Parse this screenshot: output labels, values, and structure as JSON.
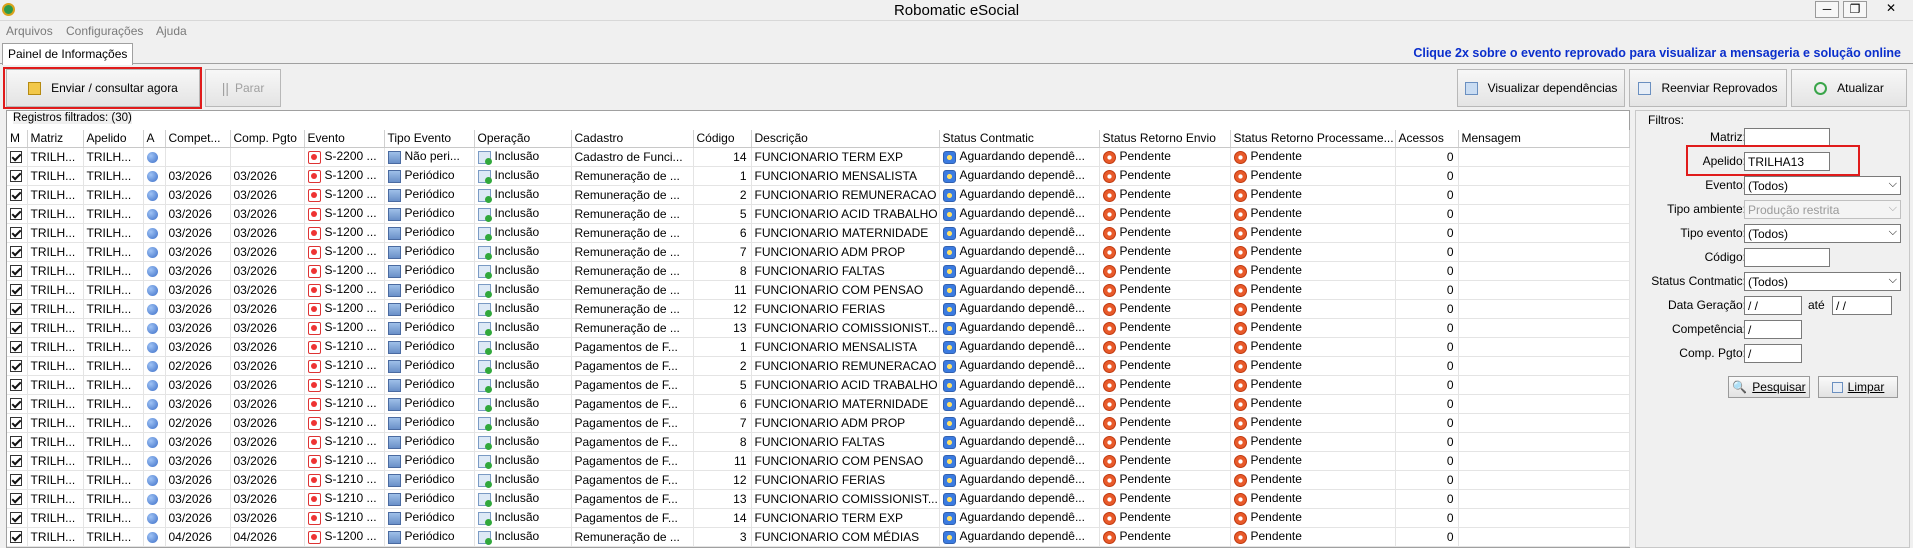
{
  "window": {
    "title": "Robomatic eSocial",
    "controls": [
      "─",
      "❐",
      "✕"
    ]
  },
  "menu": [
    "Arquivos",
    "Configurações",
    "Ajuda"
  ],
  "tab": "Painel de Informações",
  "hint": "Clique 2x sobre o evento reprovado para visualizar a mensageria e solução online",
  "toolbar": {
    "send": "Enviar / consultar agora",
    "stop": "Parar",
    "deps": "Visualizar dependências",
    "resend": "Reenviar Reprovados",
    "refresh": "Atualizar"
  },
  "records_label": "Registros filtrados: (30)",
  "columns": [
    "M",
    "Matriz",
    "Apelido",
    "A",
    "Compet...",
    "Comp. Pgto",
    "Evento",
    "Tipo Evento",
    "Operação",
    "Cadastro",
    "Código",
    "Descrição",
    "Status Contmatic",
    "Status Retorno Envio",
    "Status Retorno Processame...",
    "Acessos",
    "Mensagem"
  ],
  "rows": [
    {
      "matriz": "TRILH...",
      "apelido": "TRILH...",
      "compet": "",
      "comp_pgto": "",
      "evento": "S-2200 ...",
      "tipo": "Não peri...",
      "operacao": "Inclusão",
      "cadastro": "Cadastro de Funci...",
      "codigo": "14",
      "descricao": "FUNCIONARIO TERM EXP",
      "status": "Aguardando dependê...",
      "envio": "Pendente",
      "proc": "Pendente",
      "acessos": "0",
      "mensagem": ""
    },
    {
      "matriz": "TRILH...",
      "apelido": "TRILH...",
      "compet": "03/2026",
      "comp_pgto": "03/2026",
      "evento": "S-1200 ...",
      "tipo": "Periódico",
      "operacao": "Inclusão",
      "cadastro": "Remuneração de ...",
      "codigo": "1",
      "descricao": "FUNCIONARIO MENSALISTA",
      "status": "Aguardando dependê...",
      "envio": "Pendente",
      "proc": "Pendente",
      "acessos": "0",
      "mensagem": ""
    },
    {
      "matriz": "TRILH...",
      "apelido": "TRILH...",
      "compet": "03/2026",
      "comp_pgto": "03/2026",
      "evento": "S-1200 ...",
      "tipo": "Periódico",
      "operacao": "Inclusão",
      "cadastro": "Remuneração de ...",
      "codigo": "2",
      "descricao": "FUNCIONARIO REMUNERACAO",
      "status": "Aguardando dependê...",
      "envio": "Pendente",
      "proc": "Pendente",
      "acessos": "0",
      "mensagem": ""
    },
    {
      "matriz": "TRILH...",
      "apelido": "TRILH...",
      "compet": "03/2026",
      "comp_pgto": "03/2026",
      "evento": "S-1200 ...",
      "tipo": "Periódico",
      "operacao": "Inclusão",
      "cadastro": "Remuneração de ...",
      "codigo": "5",
      "descricao": "FUNCIONARIO ACID TRABALHO",
      "status": "Aguardando dependê...",
      "envio": "Pendente",
      "proc": "Pendente",
      "acessos": "0",
      "mensagem": ""
    },
    {
      "matriz": "TRILH...",
      "apelido": "TRILH...",
      "compet": "03/2026",
      "comp_pgto": "03/2026",
      "evento": "S-1200 ...",
      "tipo": "Periódico",
      "operacao": "Inclusão",
      "cadastro": "Remuneração de ...",
      "codigo": "6",
      "descricao": "FUNCIONARIO MATERNIDADE",
      "status": "Aguardando dependê...",
      "envio": "Pendente",
      "proc": "Pendente",
      "acessos": "0",
      "mensagem": ""
    },
    {
      "matriz": "TRILH...",
      "apelido": "TRILH...",
      "compet": "03/2026",
      "comp_pgto": "03/2026",
      "evento": "S-1200 ...",
      "tipo": "Periódico",
      "operacao": "Inclusão",
      "cadastro": "Remuneração de ...",
      "codigo": "7",
      "descricao": "FUNCIONARIO ADM PROP",
      "status": "Aguardando dependê...",
      "envio": "Pendente",
      "proc": "Pendente",
      "acessos": "0",
      "mensagem": ""
    },
    {
      "matriz": "TRILH...",
      "apelido": "TRILH...",
      "compet": "03/2026",
      "comp_pgto": "03/2026",
      "evento": "S-1200 ...",
      "tipo": "Periódico",
      "operacao": "Inclusão",
      "cadastro": "Remuneração de ...",
      "codigo": "8",
      "descricao": "FUNCIONARIO FALTAS",
      "status": "Aguardando dependê...",
      "envio": "Pendente",
      "proc": "Pendente",
      "acessos": "0",
      "mensagem": ""
    },
    {
      "matriz": "TRILH...",
      "apelido": "TRILH...",
      "compet": "03/2026",
      "comp_pgto": "03/2026",
      "evento": "S-1200 ...",
      "tipo": "Periódico",
      "operacao": "Inclusão",
      "cadastro": "Remuneração de ...",
      "codigo": "11",
      "descricao": "FUNCIONARIO COM PENSAO",
      "status": "Aguardando dependê...",
      "envio": "Pendente",
      "proc": "Pendente",
      "acessos": "0",
      "mensagem": ""
    },
    {
      "matriz": "TRILH...",
      "apelido": "TRILH...",
      "compet": "03/2026",
      "comp_pgto": "03/2026",
      "evento": "S-1200 ...",
      "tipo": "Periódico",
      "operacao": "Inclusão",
      "cadastro": "Remuneração de ...",
      "codigo": "12",
      "descricao": "FUNCIONARIO FERIAS",
      "status": "Aguardando dependê...",
      "envio": "Pendente",
      "proc": "Pendente",
      "acessos": "0",
      "mensagem": ""
    },
    {
      "matriz": "TRILH...",
      "apelido": "TRILH...",
      "compet": "03/2026",
      "comp_pgto": "03/2026",
      "evento": "S-1200 ...",
      "tipo": "Periódico",
      "operacao": "Inclusão",
      "cadastro": "Remuneração de ...",
      "codigo": "13",
      "descricao": "FUNCIONARIO COMISSIONIST...",
      "status": "Aguardando dependê...",
      "envio": "Pendente",
      "proc": "Pendente",
      "acessos": "0",
      "mensagem": ""
    },
    {
      "matriz": "TRILH...",
      "apelido": "TRILH...",
      "compet": "03/2026",
      "comp_pgto": "03/2026",
      "evento": "S-1210 ...",
      "tipo": "Periódico",
      "operacao": "Inclusão",
      "cadastro": "Pagamentos de F...",
      "codigo": "1",
      "descricao": "FUNCIONARIO MENSALISTA",
      "status": "Aguardando dependê...",
      "envio": "Pendente",
      "proc": "Pendente",
      "acessos": "0",
      "mensagem": ""
    },
    {
      "matriz": "TRILH...",
      "apelido": "TRILH...",
      "compet": "02/2026",
      "comp_pgto": "03/2026",
      "evento": "S-1210 ...",
      "tipo": "Periódico",
      "operacao": "Inclusão",
      "cadastro": "Pagamentos de F...",
      "codigo": "2",
      "descricao": "FUNCIONARIO REMUNERACAO",
      "status": "Aguardando dependê...",
      "envio": "Pendente",
      "proc": "Pendente",
      "acessos": "0",
      "mensagem": ""
    },
    {
      "matriz": "TRILH...",
      "apelido": "TRILH...",
      "compet": "03/2026",
      "comp_pgto": "03/2026",
      "evento": "S-1210 ...",
      "tipo": "Periódico",
      "operacao": "Inclusão",
      "cadastro": "Pagamentos de F...",
      "codigo": "5",
      "descricao": "FUNCIONARIO ACID TRABALHO",
      "status": "Aguardando dependê...",
      "envio": "Pendente",
      "proc": "Pendente",
      "acessos": "0",
      "mensagem": ""
    },
    {
      "matriz": "TRILH...",
      "apelido": "TRILH...",
      "compet": "03/2026",
      "comp_pgto": "03/2026",
      "evento": "S-1210 ...",
      "tipo": "Periódico",
      "operacao": "Inclusão",
      "cadastro": "Pagamentos de F...",
      "codigo": "6",
      "descricao": "FUNCIONARIO MATERNIDADE",
      "status": "Aguardando dependê...",
      "envio": "Pendente",
      "proc": "Pendente",
      "acessos": "0",
      "mensagem": ""
    },
    {
      "matriz": "TRILH...",
      "apelido": "TRILH...",
      "compet": "02/2026",
      "comp_pgto": "03/2026",
      "evento": "S-1210 ...",
      "tipo": "Periódico",
      "operacao": "Inclusão",
      "cadastro": "Pagamentos de F...",
      "codigo": "7",
      "descricao": "FUNCIONARIO ADM PROP",
      "status": "Aguardando dependê...",
      "envio": "Pendente",
      "proc": "Pendente",
      "acessos": "0",
      "mensagem": ""
    },
    {
      "matriz": "TRILH...",
      "apelido": "TRILH...",
      "compet": "03/2026",
      "comp_pgto": "03/2026",
      "evento": "S-1210 ...",
      "tipo": "Periódico",
      "operacao": "Inclusão",
      "cadastro": "Pagamentos de F...",
      "codigo": "8",
      "descricao": "FUNCIONARIO FALTAS",
      "status": "Aguardando dependê...",
      "envio": "Pendente",
      "proc": "Pendente",
      "acessos": "0",
      "mensagem": ""
    },
    {
      "matriz": "TRILH...",
      "apelido": "TRILH...",
      "compet": "03/2026",
      "comp_pgto": "03/2026",
      "evento": "S-1210 ...",
      "tipo": "Periódico",
      "operacao": "Inclusão",
      "cadastro": "Pagamentos de F...",
      "codigo": "11",
      "descricao": "FUNCIONARIO COM PENSAO",
      "status": "Aguardando dependê...",
      "envio": "Pendente",
      "proc": "Pendente",
      "acessos": "0",
      "mensagem": ""
    },
    {
      "matriz": "TRILH...",
      "apelido": "TRILH...",
      "compet": "03/2026",
      "comp_pgto": "03/2026",
      "evento": "S-1210 ...",
      "tipo": "Periódico",
      "operacao": "Inclusão",
      "cadastro": "Pagamentos de F...",
      "codigo": "12",
      "descricao": "FUNCIONARIO FERIAS",
      "status": "Aguardando dependê...",
      "envio": "Pendente",
      "proc": "Pendente",
      "acessos": "0",
      "mensagem": ""
    },
    {
      "matriz": "TRILH...",
      "apelido": "TRILH...",
      "compet": "03/2026",
      "comp_pgto": "03/2026",
      "evento": "S-1210 ...",
      "tipo": "Periódico",
      "operacao": "Inclusão",
      "cadastro": "Pagamentos de F...",
      "codigo": "13",
      "descricao": "FUNCIONARIO COMISSIONIST...",
      "status": "Aguardando dependê...",
      "envio": "Pendente",
      "proc": "Pendente",
      "acessos": "0",
      "mensagem": ""
    },
    {
      "matriz": "TRILH...",
      "apelido": "TRILH...",
      "compet": "03/2026",
      "comp_pgto": "03/2026",
      "evento": "S-1210 ...",
      "tipo": "Periódico",
      "operacao": "Inclusão",
      "cadastro": "Pagamentos de F...",
      "codigo": "14",
      "descricao": "FUNCIONARIO TERM EXP",
      "status": "Aguardando dependê...",
      "envio": "Pendente",
      "proc": "Pendente",
      "acessos": "0",
      "mensagem": ""
    },
    {
      "matriz": "TRILH...",
      "apelido": "TRILH...",
      "compet": "04/2026",
      "comp_pgto": "04/2026",
      "evento": "S-1200 ...",
      "tipo": "Periódico",
      "operacao": "Inclusão",
      "cadastro": "Remuneração de ...",
      "codigo": "3",
      "descricao": "FUNCIONARIO COM MÉDIAS",
      "status": "Aguardando dependê...",
      "envio": "Pendente",
      "proc": "Pendente",
      "acessos": "0",
      "mensagem": ""
    }
  ],
  "filters": {
    "title": "Filtros:",
    "matriz_label": "Matriz:",
    "matriz_value": "",
    "apelido_label": "Apelido:",
    "apelido_value": "TRILHA13",
    "evento_label": "Evento:",
    "evento_value": "(Todos)",
    "ambiente_label": "Tipo ambiente:",
    "ambiente_value": "Produção restrita",
    "tipo_evento_label": "Tipo evento:",
    "tipo_evento_value": "(Todos)",
    "codigo_label": "Código:",
    "codigo_value": "",
    "status_label": "Status Contmatic:",
    "status_value": "(Todos)",
    "data_label": "Data Geração:",
    "data_from": " / /",
    "ate": "até",
    "data_to": " / /",
    "competencia_label": "Competência:",
    "competencia_value": " /",
    "comp_pgto_label": "Comp. Pgto:",
    "comp_pgto_value": " /",
    "search": "Pesquisar",
    "clear": "Limpar"
  }
}
